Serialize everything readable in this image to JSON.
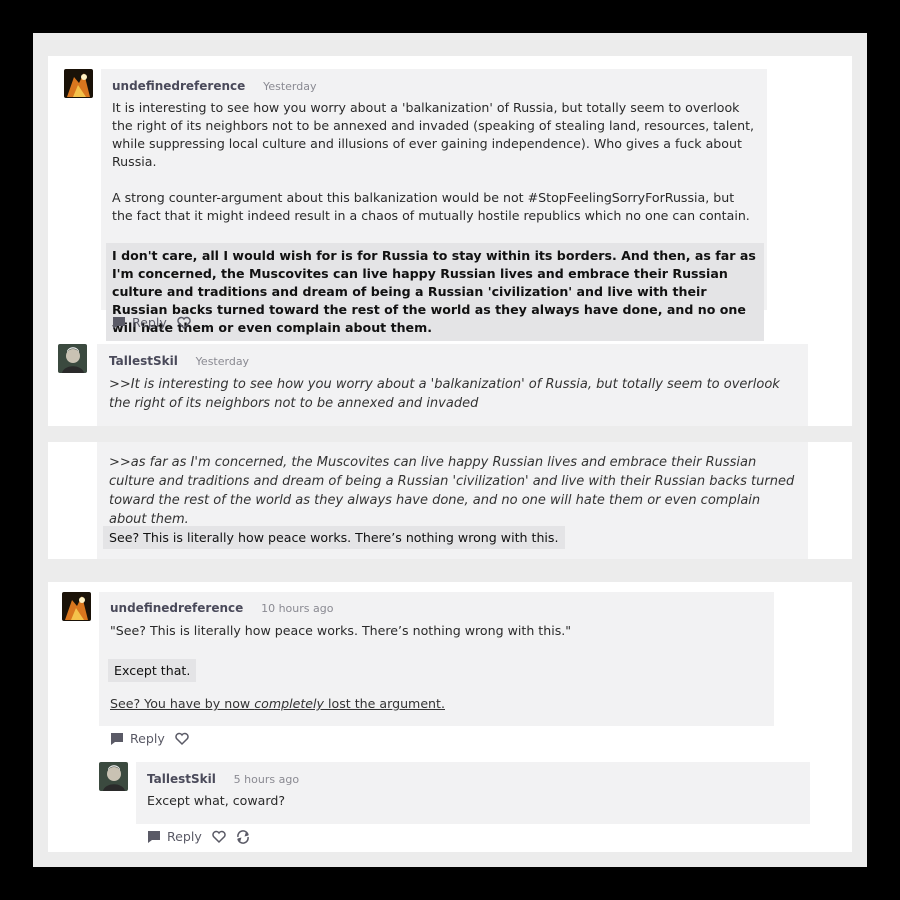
{
  "comments": {
    "c1": {
      "author": "undefinedreference",
      "time": "Yesterday",
      "p1": "It is interesting to see how you worry about a 'balkanization' of Russia, but totally seem to overlook the right of its neighbors not to be annexed and invaded (speaking of stealing land, resources, talent, while suppressing local culture and illusions of ever gaining independence). Who gives a fuck about Russia.",
      "p2": "A strong counter-argument about this balkanization would be not #StopFeelingSorryForRussia, but the fact that it might indeed result in a chaos of mutually hostile republics which no one can contain.",
      "p3": "I don't care, all I would wish for is for Russia to stay within its borders. And then, as far as I'm concerned, the Muscovites can live happy Russian lives and embrace their Russian culture and traditions and dream of being a Russian 'civilization' and live with their Russian backs turned toward the rest of the world as they always have done, and no one will hate them or even complain about them.",
      "reply_label": "Reply"
    },
    "c2": {
      "author": "TallestSkil",
      "time": "Yesterday",
      "quote1": ">>It is interesting to see how you worry about a 'balkanization' of Russia, but totally seem to overlook the right of its neighbors not to be annexed and invaded",
      "quote2": ">>as far as I'm concerned, the Muscovites can live happy Russian lives and embrace their Russian culture and traditions and dream of being a Russian 'civilization' and live with their Russian backs turned toward the rest of the world as they always have done, and no one will hate them or even complain about them.",
      "reply_text": "See? This is literally how peace works. There’s nothing wrong with this."
    },
    "c3": {
      "author": "undefinedreference",
      "time": "10 hours ago",
      "p1": "\"See? This is literally how peace works. There’s nothing wrong with this.\"",
      "p2": "Except that.",
      "p3_a": "See? You have by now ",
      "p3_em": "completely",
      "p3_b": " lost the argument.",
      "reply_label": "Reply"
    },
    "c4": {
      "author": "TallestSkil",
      "time": "5 hours ago",
      "p1": "Except what, coward?",
      "reply_label": "Reply"
    }
  },
  "icons": {
    "reply": "reply-bubble-icon",
    "like": "heart-icon",
    "share": "share-icon"
  }
}
